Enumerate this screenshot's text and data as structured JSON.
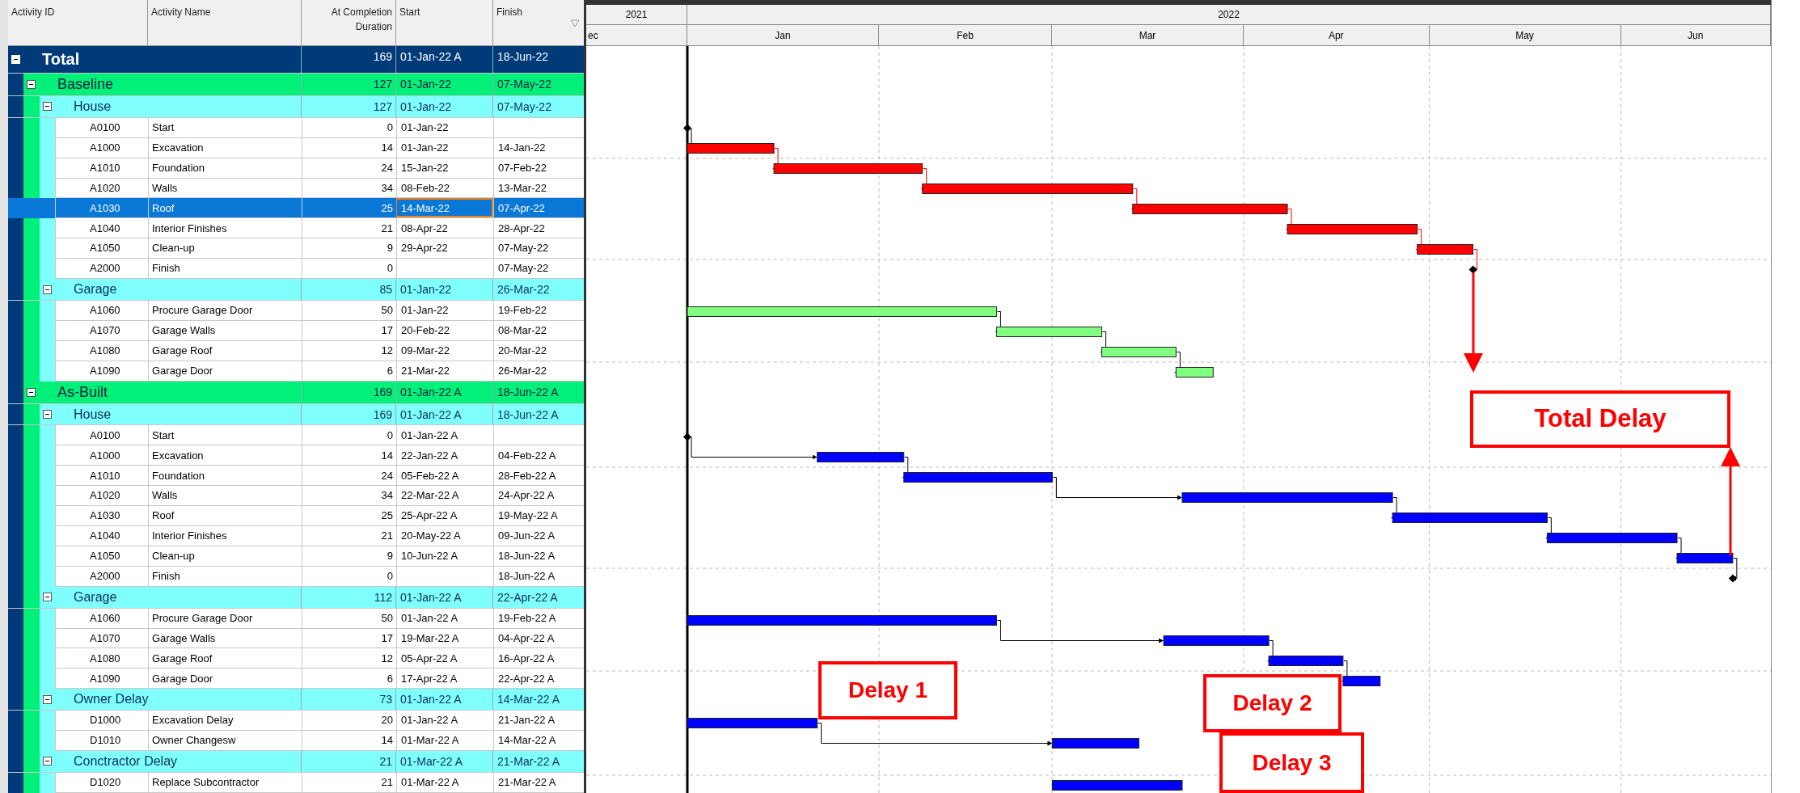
{
  "columns": [
    {
      "label": "Activity ID"
    },
    {
      "label": "Activity Name"
    },
    {
      "label": "At Completion Duration"
    },
    {
      "label": "Start"
    },
    {
      "label": "Finish"
    }
  ],
  "timescale": {
    "years": [
      "2021",
      "2022"
    ],
    "months": [
      "ec",
      "Jan",
      "Feb",
      "Mar",
      "Apr",
      "May",
      "Jun"
    ]
  },
  "total": {
    "label": "Total",
    "expanded": true,
    "duration": "169",
    "start": "01-Jan-22 A",
    "finish": "18-Jun-22",
    "children": [
      {
        "label": "Baseline",
        "expanded": true,
        "duration": "127",
        "start": "01-Jan-22",
        "finish": "07-May-22",
        "children": [
          {
            "label": "House",
            "expanded": true,
            "duration": "127",
            "start": "01-Jan-22",
            "finish": "07-May-22",
            "children": [
              {
                "id": "A0100",
                "name": "Start",
                "duration": "0",
                "start": "01-Jan-22",
                "kind": "milestone",
                "selected": false
              },
              {
                "id": "A1000",
                "name": "Excavation",
                "duration": "14",
                "start": "01-Jan-22",
                "finish": "14-Jan-22",
                "kind": "task",
                "color": "#ff0000",
                "selected": false
              },
              {
                "id": "A1010",
                "name": "Foundation",
                "duration": "24",
                "start": "15-Jan-22",
                "finish": "07-Feb-22",
                "kind": "task",
                "color": "#ff0000",
                "selected": false
              },
              {
                "id": "A1020",
                "name": "Walls",
                "duration": "34",
                "start": "08-Feb-22",
                "finish": "13-Mar-22",
                "kind": "task",
                "color": "#ff0000",
                "selected": false
              },
              {
                "id": "A1030",
                "name": "Roof",
                "duration": "25",
                "start": "14-Mar-22",
                "finish": "07-Apr-22",
                "kind": "task",
                "color": "#ff0000",
                "selected": true
              },
              {
                "id": "A1040",
                "name": "Interior Finishes",
                "duration": "21",
                "start": "08-Apr-22",
                "finish": "28-Apr-22",
                "kind": "task",
                "color": "#ff0000",
                "selected": false
              },
              {
                "id": "A1050",
                "name": "Clean-up",
                "duration": "9",
                "start": "29-Apr-22",
                "finish": "07-May-22",
                "kind": "task",
                "color": "#ff0000",
                "selected": false
              },
              {
                "id": "A2000",
                "name": "Finish",
                "duration": "0",
                "finish": "07-May-22",
                "kind": "milestone",
                "selected": false
              }
            ]
          },
          {
            "label": "Garage",
            "expanded": true,
            "duration": "85",
            "start": "01-Jan-22",
            "finish": "26-Mar-22",
            "children": [
              {
                "id": "A1060",
                "name": "Procure Garage Door",
                "duration": "50",
                "start": "01-Jan-22",
                "finish": "19-Feb-22",
                "kind": "task",
                "color": "#80ff80",
                "selected": false
              },
              {
                "id": "A1070",
                "name": "Garage Walls",
                "duration": "17",
                "start": "20-Feb-22",
                "finish": "08-Mar-22",
                "kind": "task",
                "color": "#80ff80",
                "selected": false
              },
              {
                "id": "A1080",
                "name": "Garage Roof",
                "duration": "12",
                "start": "09-Mar-22",
                "finish": "20-Mar-22",
                "kind": "task",
                "color": "#80ff80",
                "selected": false
              },
              {
                "id": "A1090",
                "name": "Garage Door",
                "duration": "6",
                "start": "21-Mar-22",
                "finish": "26-Mar-22",
                "kind": "task",
                "color": "#80ff80",
                "selected": false
              }
            ]
          }
        ]
      },
      {
        "label": "As-Built",
        "expanded": true,
        "duration": "169",
        "start": "01-Jan-22 A",
        "finish": "18-Jun-22 A",
        "children": [
          {
            "label": "House",
            "expanded": true,
            "duration": "169",
            "start": "01-Jan-22 A",
            "finish": "18-Jun-22 A",
            "children": [
              {
                "id": "A0100",
                "name": "Start",
                "duration": "0",
                "start": "01-Jan-22 A",
                "kind": "milestone",
                "selected": false
              },
              {
                "id": "A1000",
                "name": "Excavation",
                "duration": "14",
                "start": "22-Jan-22 A",
                "finish": "04-Feb-22 A",
                "kind": "task",
                "color": "#0000ff",
                "selected": false
              },
              {
                "id": "A1010",
                "name": "Foundation",
                "duration": "24",
                "start": "05-Feb-22 A",
                "finish": "28-Feb-22 A",
                "kind": "task",
                "color": "#0000ff",
                "selected": false
              },
              {
                "id": "A1020",
                "name": "Walls",
                "duration": "34",
                "start": "22-Mar-22 A",
                "finish": "24-Apr-22 A",
                "kind": "task",
                "color": "#0000ff",
                "selected": false
              },
              {
                "id": "A1030",
                "name": "Roof",
                "duration": "25",
                "start": "25-Apr-22 A",
                "finish": "19-May-22 A",
                "kind": "task",
                "color": "#0000ff",
                "selected": false
              },
              {
                "id": "A1040",
                "name": "Interior Finishes",
                "duration": "21",
                "start": "20-May-22 A",
                "finish": "09-Jun-22 A",
                "kind": "task",
                "color": "#0000ff",
                "selected": false
              },
              {
                "id": "A1050",
                "name": "Clean-up",
                "duration": "9",
                "start": "10-Jun-22 A",
                "finish": "18-Jun-22 A",
                "kind": "task",
                "color": "#0000ff",
                "selected": false
              },
              {
                "id": "A2000",
                "name": "Finish",
                "duration": "0",
                "finish": "18-Jun-22 A",
                "kind": "milestone",
                "selected": false
              }
            ]
          },
          {
            "label": "Garage",
            "expanded": true,
            "duration": "112",
            "start": "01-Jan-22 A",
            "finish": "22-Apr-22 A",
            "children": [
              {
                "id": "A1060",
                "name": "Procure Garage Door",
                "duration": "50",
                "start": "01-Jan-22 A",
                "finish": "19-Feb-22 A",
                "kind": "task",
                "color": "#0000ff",
                "selected": false
              },
              {
                "id": "A1070",
                "name": "Garage Walls",
                "duration": "17",
                "start": "19-Mar-22 A",
                "finish": "04-Apr-22 A",
                "kind": "task",
                "color": "#0000ff",
                "selected": false
              },
              {
                "id": "A1080",
                "name": "Garage Roof",
                "duration": "12",
                "start": "05-Apr-22 A",
                "finish": "16-Apr-22 A",
                "kind": "task",
                "color": "#0000ff",
                "selected": false
              },
              {
                "id": "A1090",
                "name": "Garage Door",
                "duration": "6",
                "start": "17-Apr-22 A",
                "finish": "22-Apr-22 A",
                "kind": "task",
                "color": "#0000ff",
                "selected": false
              }
            ]
          },
          {
            "label": "Owner Delay",
            "expanded": true,
            "duration": "73",
            "start": "01-Jan-22 A",
            "finish": "14-Mar-22 A",
            "children": [
              {
                "id": "D1000",
                "name": "Excavation Delay",
                "duration": "20",
                "start": "01-Jan-22 A",
                "finish": "21-Jan-22 A",
                "kind": "task",
                "color": "#0000ff",
                "selected": false
              },
              {
                "id": "D1010",
                "name": "Owner Changesw",
                "duration": "14",
                "start": "01-Mar-22 A",
                "finish": "14-Mar-22 A",
                "kind": "task",
                "color": "#0000ff",
                "selected": false
              }
            ]
          },
          {
            "label": "Conctractor Delay",
            "expanded": true,
            "duration": "21",
            "start": "01-Mar-22 A",
            "finish": "21-Mar-22 A",
            "children": [
              {
                "id": "D1020",
                "name": "Replace Subcontractor",
                "duration": "21",
                "start": "01-Mar-22 A",
                "finish": "21-Mar-22 A",
                "kind": "task",
                "color": "#0000ff",
                "selected": false
              }
            ]
          }
        ]
      }
    ]
  },
  "annotations": [
    {
      "label": "Total Delay"
    },
    {
      "label": "Delay 1"
    },
    {
      "label": "Delay 2"
    },
    {
      "label": "Delay 3"
    }
  ]
}
